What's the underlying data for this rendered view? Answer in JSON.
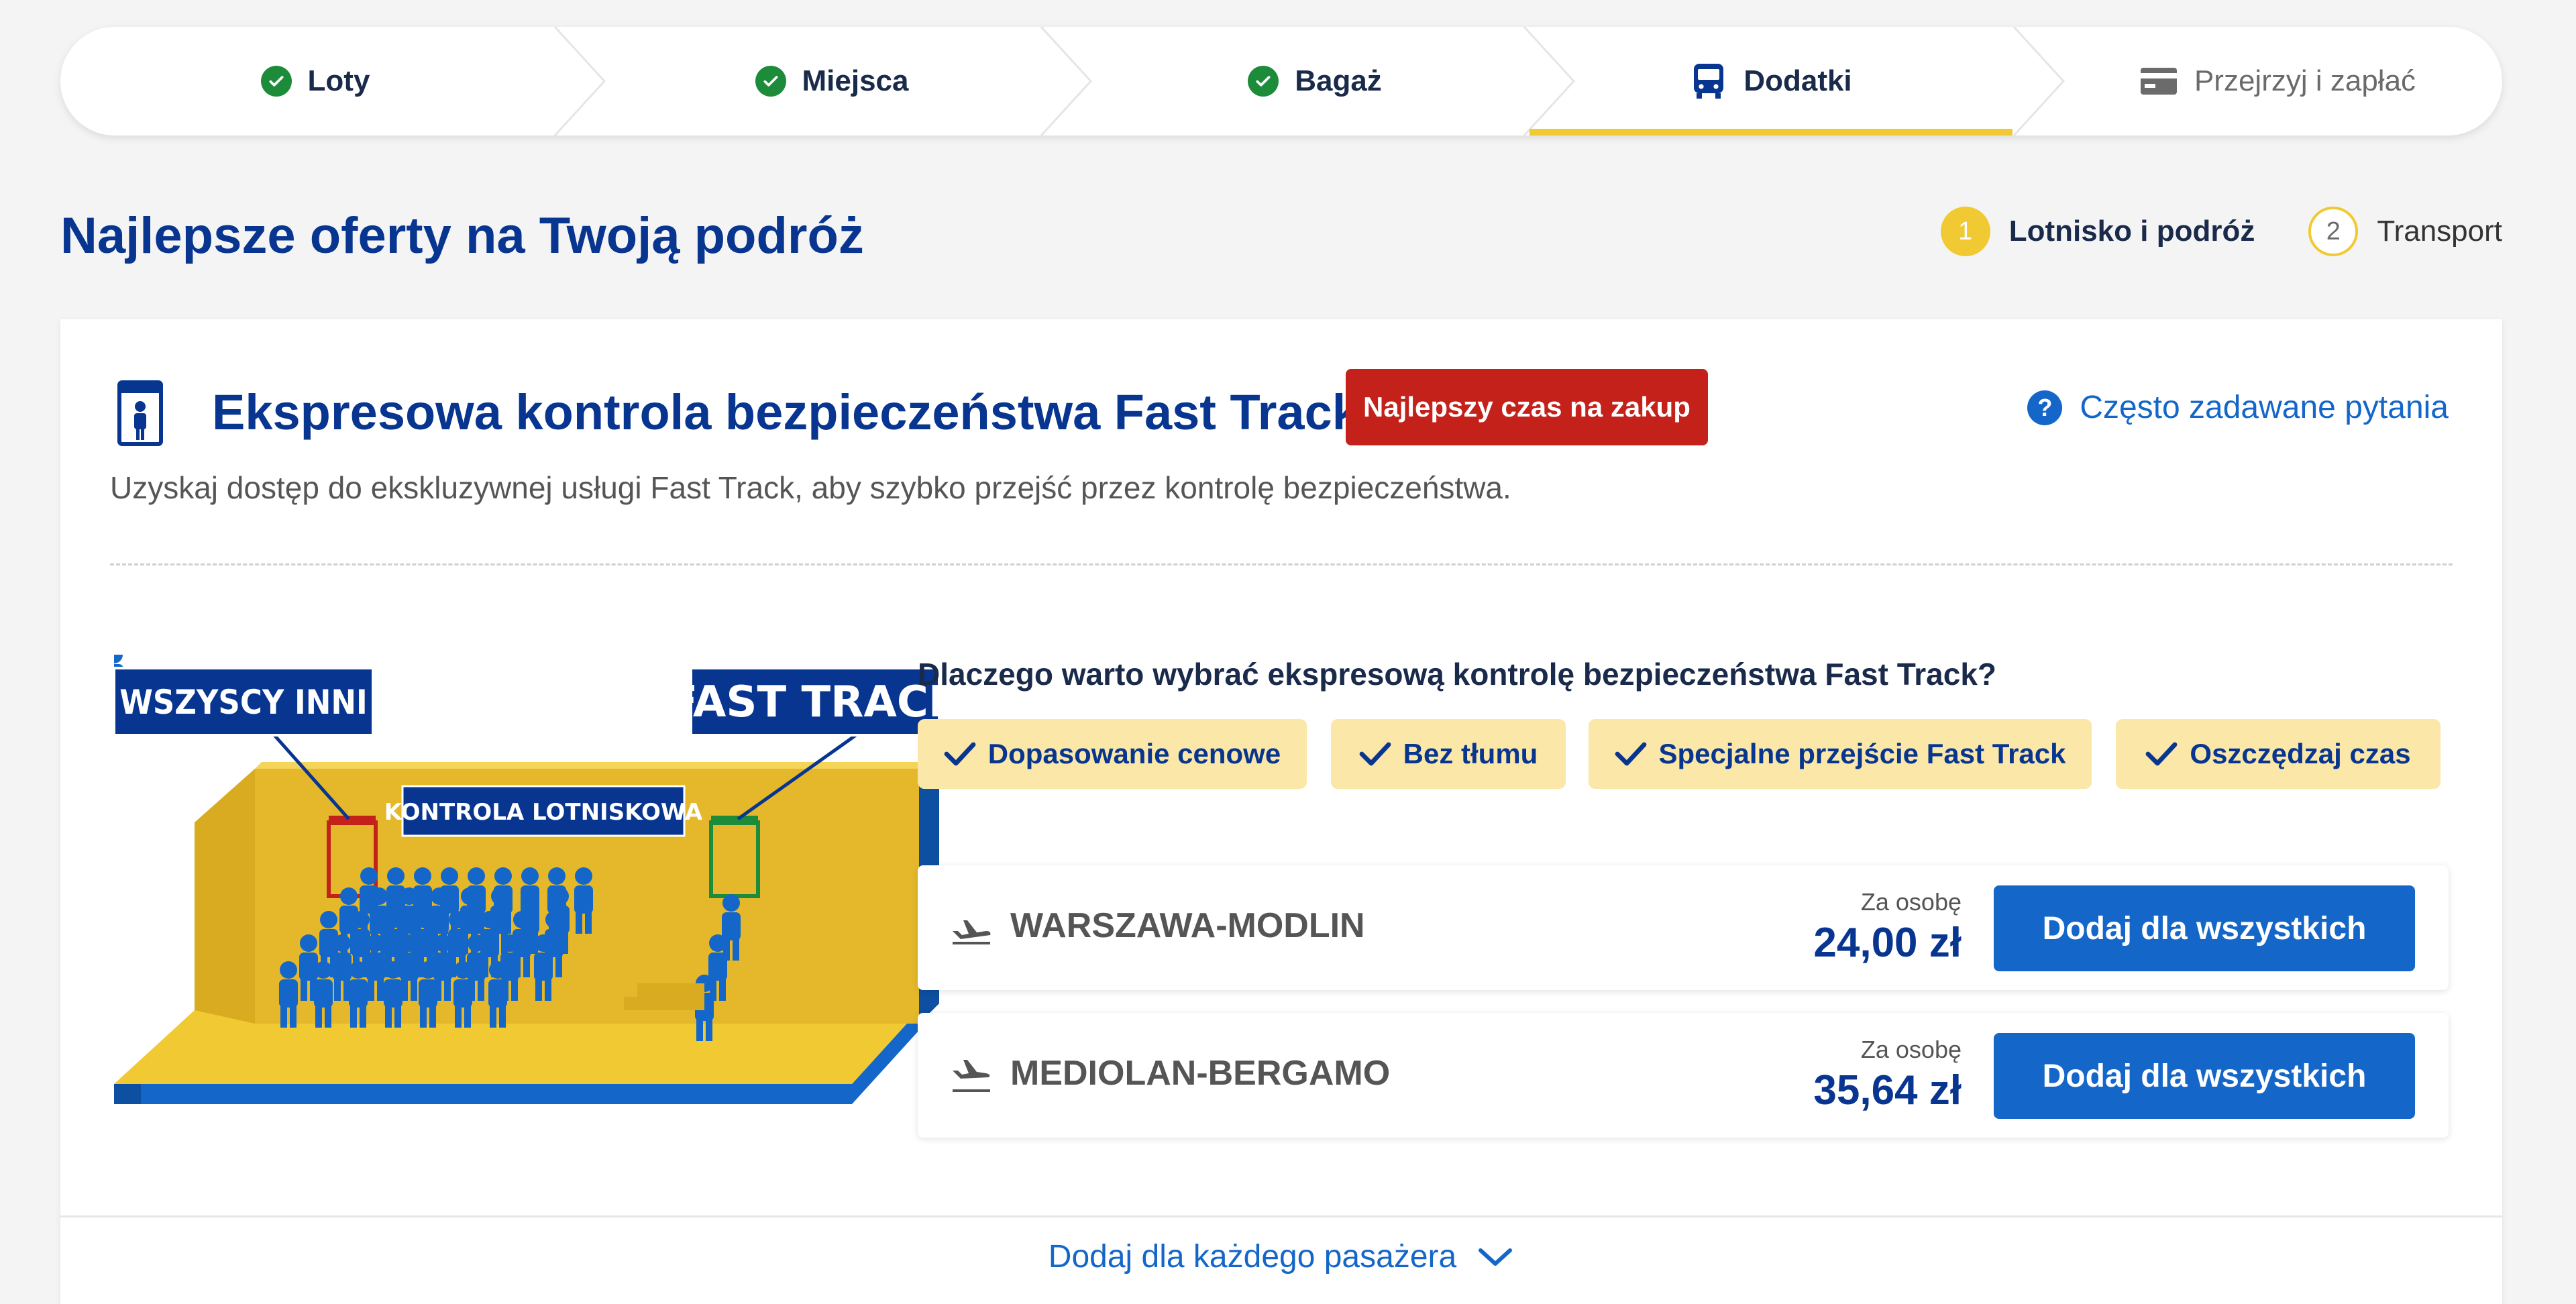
{
  "stepper": {
    "steps": [
      {
        "label": "Loty",
        "state": "done"
      },
      {
        "label": "Miejsca",
        "state": "done"
      },
      {
        "label": "Bagaż",
        "state": "done"
      },
      {
        "label": "Dodatki",
        "state": "active"
      },
      {
        "label": "Przejrzyj i zapłać",
        "state": "upcoming"
      }
    ]
  },
  "page": {
    "title": "Najlepsze oferty na Twoją podróż"
  },
  "substeps": [
    {
      "num": "1",
      "label": "Lotnisko i podróż",
      "state": "current"
    },
    {
      "num": "2",
      "label": "Transport",
      "state": "next"
    }
  ],
  "card": {
    "title": "Ekspresowa kontrola bezpieczeństwa Fast Track",
    "badge": "Najlepszy czas na zakup",
    "faq": "Często zadawane pytania",
    "description": "Uzyskaj dostęp do ekskluzywnej usługi Fast Track, aby szybko przejść przez kontrolę bezpieczeństwa.",
    "illustration": {
      "left_sign": "WSZYSCY INNI",
      "right_sign": "FAST TRACK",
      "center_sign": "KONTROLA LOTNISKOWA"
    },
    "why_title": "Dlaczego warto wybrać ekspresową kontrolę bezpieczeństwa Fast Track?",
    "benefits": [
      "Dopasowanie cenowe",
      "Bez tłumu",
      "Specjalne przejście Fast Track",
      "Oszczędzaj czas"
    ],
    "routes": [
      {
        "name": "WARSZAWA-MODLIN",
        "per_person": "Za osobę",
        "price": "24,00 zł",
        "button": "Dodaj dla wszystkich"
      },
      {
        "name": "MEDIOLAN-BERGAMO",
        "per_person": "Za osobę",
        "price": "35,64 zł",
        "button": "Dodaj dla wszystkich"
      }
    ],
    "expand_label": "Dodaj dla każdego pasażera"
  },
  "colors": {
    "brand_blue": "#073590",
    "action_blue": "#1467c8",
    "yellow": "#f1c933",
    "badge_red": "#c4211a",
    "check_green": "#1d8c3a",
    "chip_bg": "#fbe7a7"
  }
}
